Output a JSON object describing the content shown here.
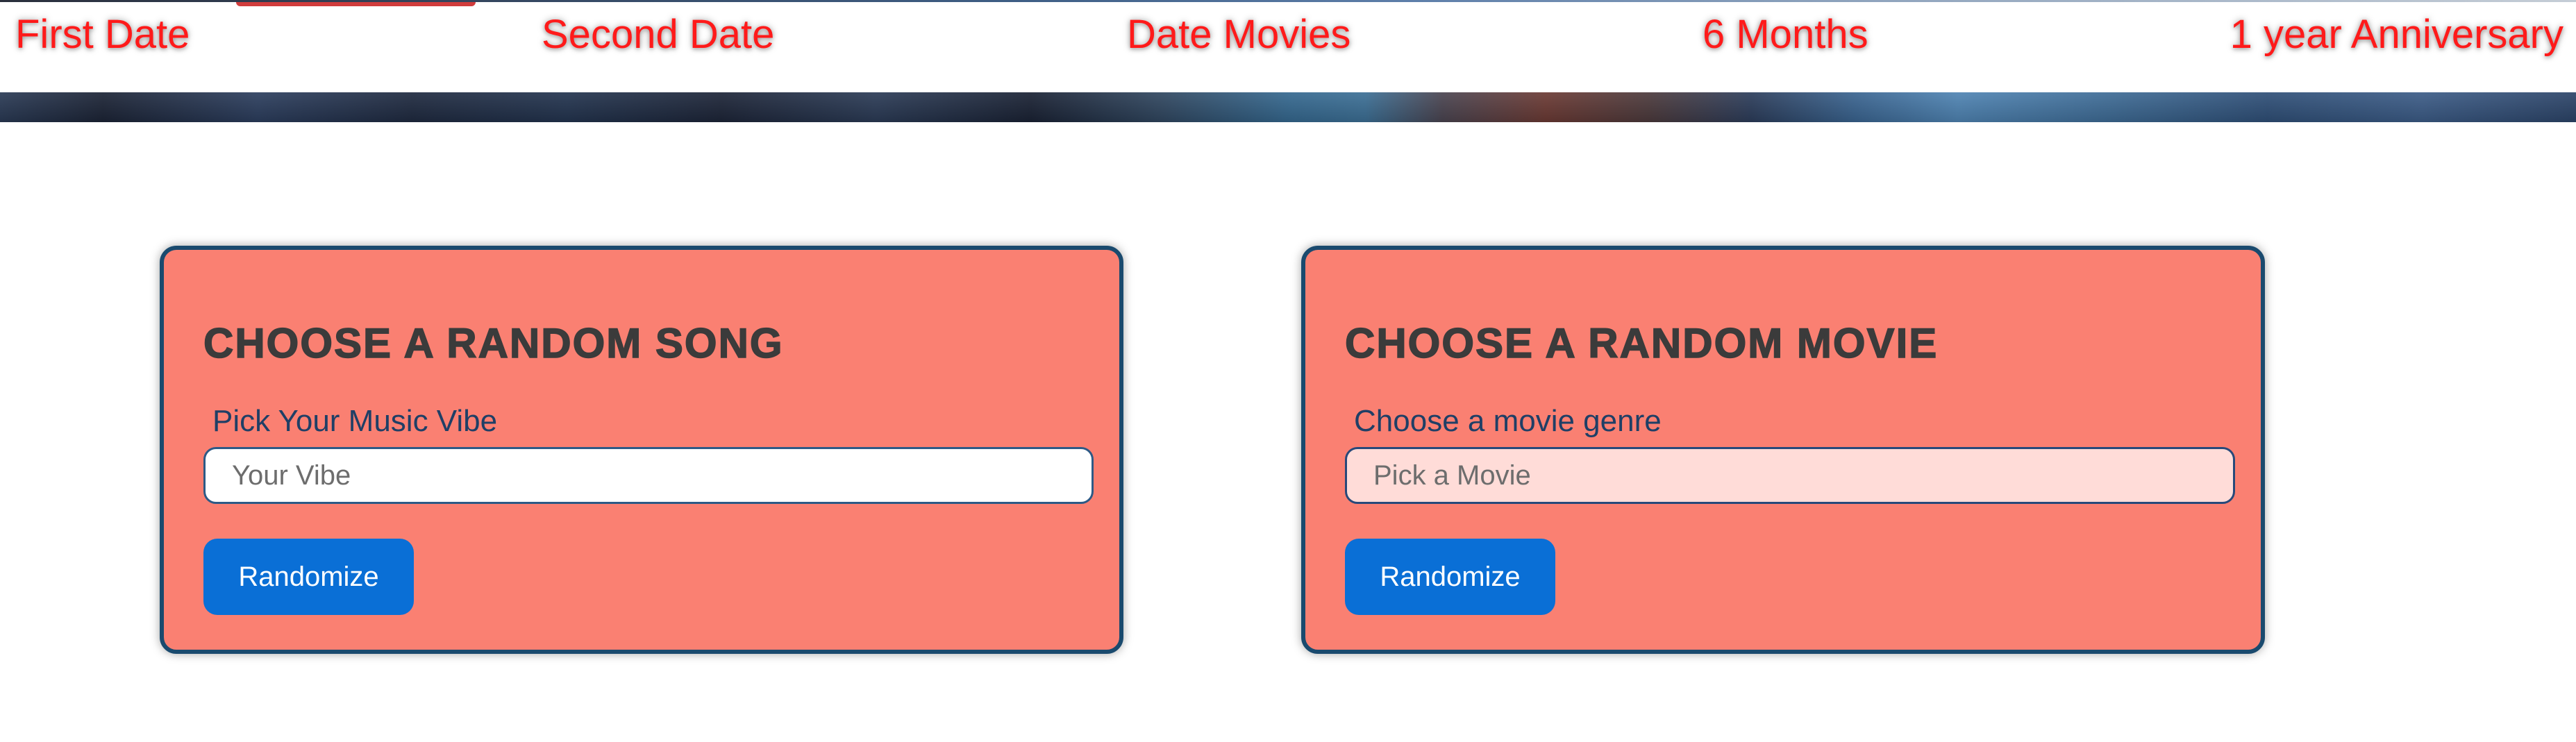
{
  "nav": {
    "links": [
      {
        "label": "First Date"
      },
      {
        "label": "Second Date"
      },
      {
        "label": "Date Movies"
      },
      {
        "label": "6 Months"
      },
      {
        "label": "1 year Anniversary"
      }
    ]
  },
  "song_card": {
    "title": "CHOOSE A RANDOM SONG",
    "label": "Pick Your Music Vibe",
    "input_placeholder": "Your Vibe",
    "input_value": "",
    "button_label": "Randomize"
  },
  "movie_card": {
    "title": "CHOOSE A RANDOM MOVIE",
    "label": "Choose a movie genre",
    "input_placeholder": "Pick a Movie",
    "input_value": "",
    "button_label": "Randomize"
  },
  "colors": {
    "nav_link": "#ff1a1a",
    "card_background": "#fa8072",
    "card_border": "#1a4a6e",
    "button": "#0a6fd6",
    "title_text": "#3b3b3b"
  }
}
